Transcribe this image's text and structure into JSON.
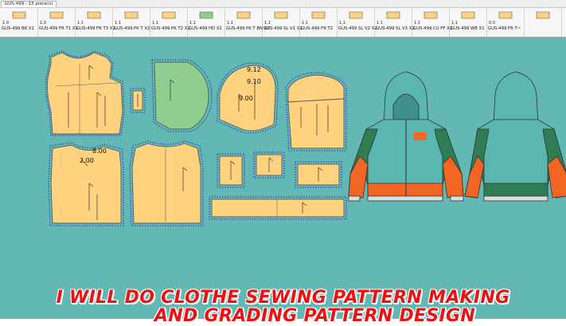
{
  "tab": {
    "label": "GUS-499 - 15 piece(s)"
  },
  "pieces": [
    {
      "num": "1.0",
      "label": "GUS-499 BK X1",
      "color": "#ffd27f"
    },
    {
      "num": "1.0",
      "label": "GUS-499 FR T1 X1",
      "color": "#ffd27f"
    },
    {
      "num": "1.1",
      "label": "GUS-499 FR T3 X1",
      "color": "#ffd27f"
    },
    {
      "num": "1.1",
      "label": "GUS-499 PK T X2",
      "color": "#ffd27f"
    },
    {
      "num": "1.1",
      "label": "GUS-499 PK T2 X2",
      "color": "#ffd27f"
    },
    {
      "num": "1.1",
      "label": "GUS-499 HD X2",
      "color": "#8fce8f"
    },
    {
      "num": "1.1",
      "label": "GUS-499 PK T BN X2",
      "color": "#ffd27f"
    },
    {
      "num": "1.1",
      "label": "GUS-499 SL V1 X2",
      "color": "#ffd27f"
    },
    {
      "num": "1.1",
      "label": "GUS-499 FR T2",
      "color": "#ffd27f"
    },
    {
      "num": "1.1",
      "label": "GUS-499 SL V2 X2",
      "color": "#ffd27f"
    },
    {
      "num": "1.1",
      "label": "GUS-499 SL V3 X2",
      "color": "#ffd27f"
    },
    {
      "num": "1.1",
      "label": "GUS-499 CU FF X2",
      "color": "#ffd27f"
    },
    {
      "num": "1.1",
      "label": "GUS-499 WB X1",
      "color": "#ffd27f"
    },
    {
      "num": "0.0",
      "label": "GUS-499 FR T~",
      "color": "#ffd27f"
    },
    {
      "num": "",
      "label": "",
      "color": "#ffd27f"
    }
  ],
  "grade_labels": [
    "9.12",
    "9.10",
    "9.00",
    "8.00",
    "2.00"
  ],
  "banner": {
    "line1": "I WILL DO CLOTHE SEWING PATTERN MAKING",
    "line2": "AND GRADING PATTERN DESIGN"
  },
  "colors": {
    "canvas": "#63b8b3",
    "piece_fill": "#ffd27f",
    "hood_fill": "#8fce8f",
    "banner_text": "#ee1111",
    "jacket_teal": "#5ab6b0",
    "jacket_green": "#2e7d55",
    "jacket_orange": "#f26522"
  }
}
